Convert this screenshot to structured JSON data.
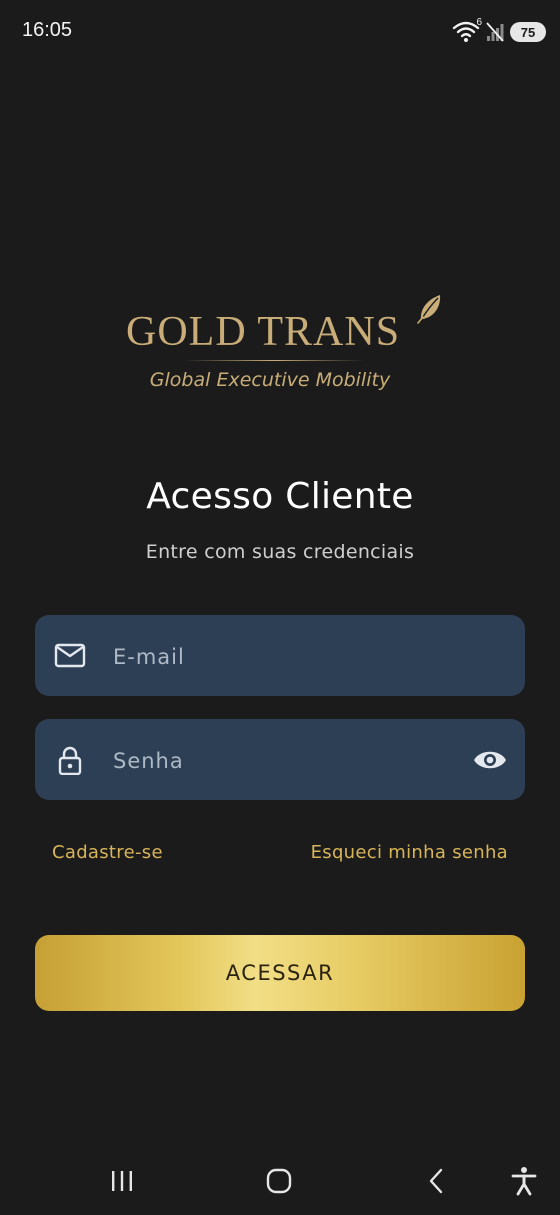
{
  "status_bar": {
    "time": "16:05",
    "wifi_badge": "6",
    "battery": "75",
    "icons": [
      "wifi-icon",
      "signal-off-icon",
      "battery-icon"
    ]
  },
  "logo": {
    "title": "GOLD TRANS",
    "tagline": "Global Executive Mobility",
    "icon": "leaf-icon"
  },
  "login": {
    "heading": "Acesso Cliente",
    "subheading": "Entre com suas credenciais",
    "email": {
      "placeholder": "E-mail",
      "value": "",
      "icon": "mail-icon"
    },
    "password": {
      "placeholder": "Senha",
      "value": "",
      "icon": "lock-icon",
      "toggle_icon": "eye-icon"
    },
    "signup_link": "Cadastre-se",
    "forgot_link": "Esqueci minha senha",
    "submit_label": "ACESSAR"
  },
  "nav_bar": {
    "buttons": [
      "recent-apps-icon",
      "home-icon",
      "back-icon",
      "accessibility-icon"
    ]
  },
  "colors": {
    "background": "#1b1b1b",
    "field": "#2d3f55",
    "brand_gold": "#c9ad78",
    "link_gold": "#d9b559",
    "button_gold": "#e3c75b"
  }
}
